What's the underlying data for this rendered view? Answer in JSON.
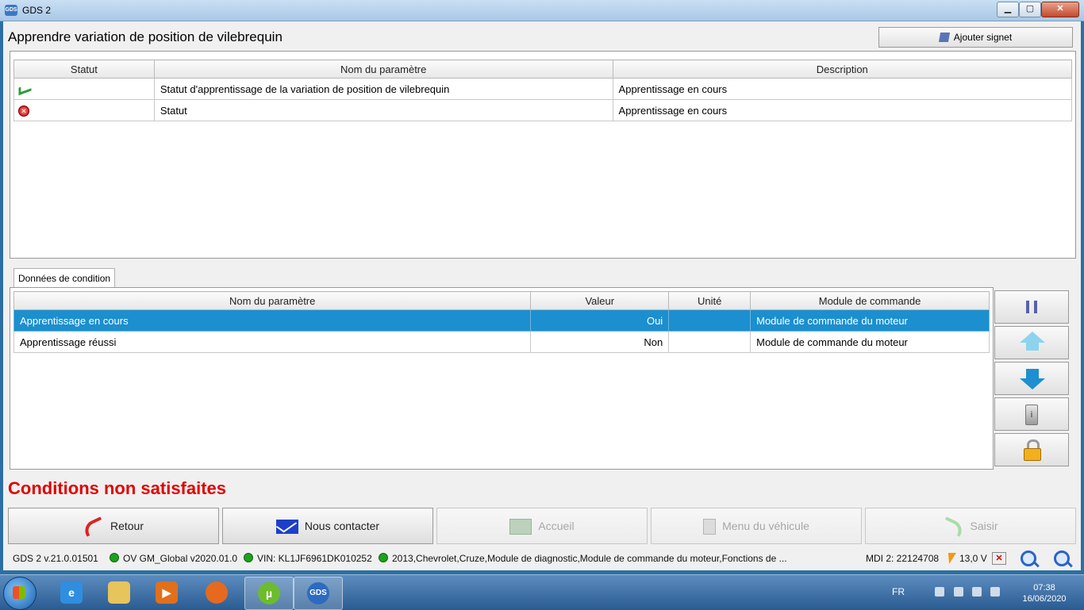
{
  "window": {
    "title": "GDS 2",
    "app_icon": "GDS",
    "min_label": "▁",
    "max_label": "▢",
    "close_label": "✕"
  },
  "header": {
    "page_title": "Apprendre variation de position de vilebrequin",
    "bookmark_label": "Ajouter signet"
  },
  "top_table": {
    "columns": [
      "Statut",
      "Nom du paramètre",
      "Description"
    ],
    "rows": [
      {
        "status_icon": "green-check-icon",
        "name": "Statut d'apprentissage de la variation de position de vilebrequin",
        "description": "Apprentissage en cours"
      },
      {
        "status_icon": "red-error-icon",
        "name": "Statut",
        "description": "Apprentissage en cours"
      }
    ]
  },
  "tab": {
    "label": "Données de condition"
  },
  "condition_table": {
    "columns": [
      "Nom du paramètre",
      "Valeur",
      "Unité",
      "Module de commande"
    ],
    "rows": [
      {
        "name": "Apprentissage en cours",
        "value": "Oui",
        "unit": "",
        "module": "Module de commande du moteur",
        "selected": true
      },
      {
        "name": "Apprentissage réussi",
        "value": "Non",
        "unit": "",
        "module": "Module de commande du moteur",
        "selected": false
      }
    ]
  },
  "side_buttons": [
    "pause-icon",
    "arrow-up-icon",
    "arrow-down-icon",
    "info-icon",
    "lock-icon"
  ],
  "message": {
    "conditions": "Conditions non satisfaites"
  },
  "nav": {
    "retour": "Retour",
    "contact": "Nous contacter",
    "accueil": "Accueil",
    "menu": "Menu du véhicule",
    "saisir": "Saisir"
  },
  "status": {
    "version": "GDS 2 v.21.0.01501",
    "ov": "OV GM_Global v2020.01.0",
    "vin": "VIN: KL1JF6961DK010252",
    "vehicle": "2013,Chevrolet,Cruze,Module de diagnostic,Module de commande du moteur,Fonctions de ...",
    "mdi": "MDI 2: 22124708",
    "voltage": "13,0 V",
    "status_color": "#1fa01f"
  },
  "taskbar": {
    "lang": "FR",
    "time": "07:38",
    "date": "16/06/2020",
    "apps": [
      "ie-icon",
      "explorer-icon",
      "media-player-icon",
      "firefox-icon",
      "utorrent-icon",
      "gds-icon"
    ]
  }
}
